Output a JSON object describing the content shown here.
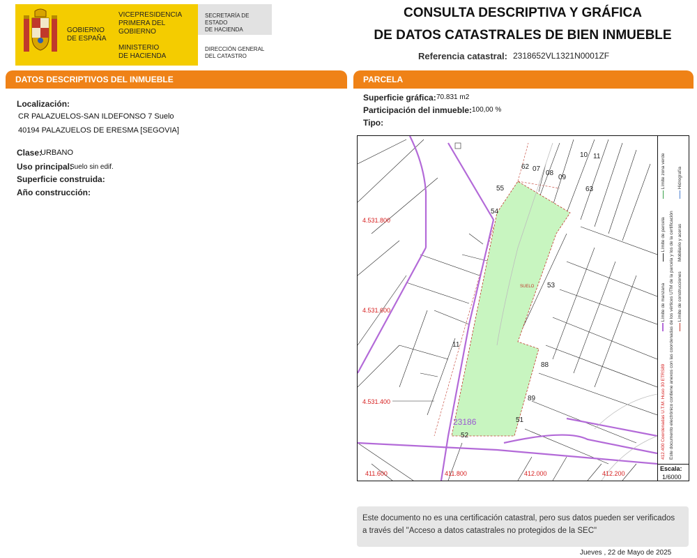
{
  "header": {
    "gobierno": [
      "GOBIERNO",
      "DE ESPAÑA"
    ],
    "vicepresidencia": [
      "VICEPRESIDENCIA",
      "PRIMERA DEL GOBIERNO"
    ],
    "ministerio": [
      "MINISTERIO",
      "DE HACIENDA"
    ],
    "secretaria": [
      "SECRETARÍA DE ESTADO",
      "DE HACIENDA"
    ],
    "direccion": [
      "DIRECCIÓN GENERAL",
      "DEL CATASTRO"
    ],
    "title_line1": "CONSULTA DESCRIPTIVA Y GRÁFICA",
    "title_line2": "DE DATOS CATASTRALES DE BIEN INMUEBLE",
    "ref_label": "Referencia catastral:",
    "ref_value": "2318652VL1321N0001ZF"
  },
  "inmueble": {
    "section_title": "DATOS DESCRIPTIVOS DEL INMUEBLE",
    "localizacion_label": "Localización:",
    "localizacion_line1": "CR PALAZUELOS-SAN ILDEFONSO 7 Suelo",
    "localizacion_line2": "40194 PALAZUELOS DE ERESMA [SEGOVIA]",
    "clase_label": "Clase:",
    "clase_value": "URBANO",
    "uso_label": "Uso principal:",
    "uso_value": "Suelo sin edif.",
    "superficie_label": "Superficie construida:",
    "anio_label": "Año construcción:"
  },
  "parcela": {
    "section_title": "PARCELA",
    "superficie_label": "Superficie gráfica:",
    "superficie_value": "70.831 m2",
    "participacion_label": "Participación del inmueble:",
    "participacion_value": "100,00 %",
    "tipo_label": "Tipo:"
  },
  "map": {
    "y_coords": [
      "4.531.800",
      "4.531.600",
      "4.531.400"
    ],
    "x_coords": [
      "411.600",
      "411.800",
      "412.000",
      "412.200"
    ],
    "parcel_numbers": [
      "62",
      "07",
      "08",
      "09",
      "10",
      "11",
      "55",
      "63",
      "54",
      "53",
      "11",
      "88",
      "89",
      "51",
      "52"
    ],
    "suelo_label": "SUELO",
    "block_label": "23186",
    "scale_label": "Escala:",
    "scale_value": "1/6000",
    "legend": {
      "limite_manzana": "Límite de manzana",
      "limite_parcela": "Límite de parcela",
      "limite_construcciones": "Límite de construcciones",
      "mobiliario": "Mobiliario y aceras",
      "limite_zona_verde": "Límite zona verde",
      "hidrografia": "Hidrografía",
      "coords_note": "412.400 Coordenadas U.T.M. Huso 30 ETRS89",
      "doc_note": "Este documento electrónico contiene anexos con las coordenadas de los vértices UTM de la parcela y los de la certificación"
    }
  },
  "footer": {
    "notice": "Este documento no es una certificación catastral, pero sus datos pueden ser verificados a través del \"Acceso a datos catastrales no protegidos de la SEC\"",
    "date": "Jueves , 22 de Mayo de 2025"
  },
  "colors": {
    "orange": "#ef8217",
    "yellow": "#f4cc00",
    "parcel_green": "#c8f5c0",
    "manzana_purple": "#b36ad8",
    "coord_red": "#d62020"
  }
}
